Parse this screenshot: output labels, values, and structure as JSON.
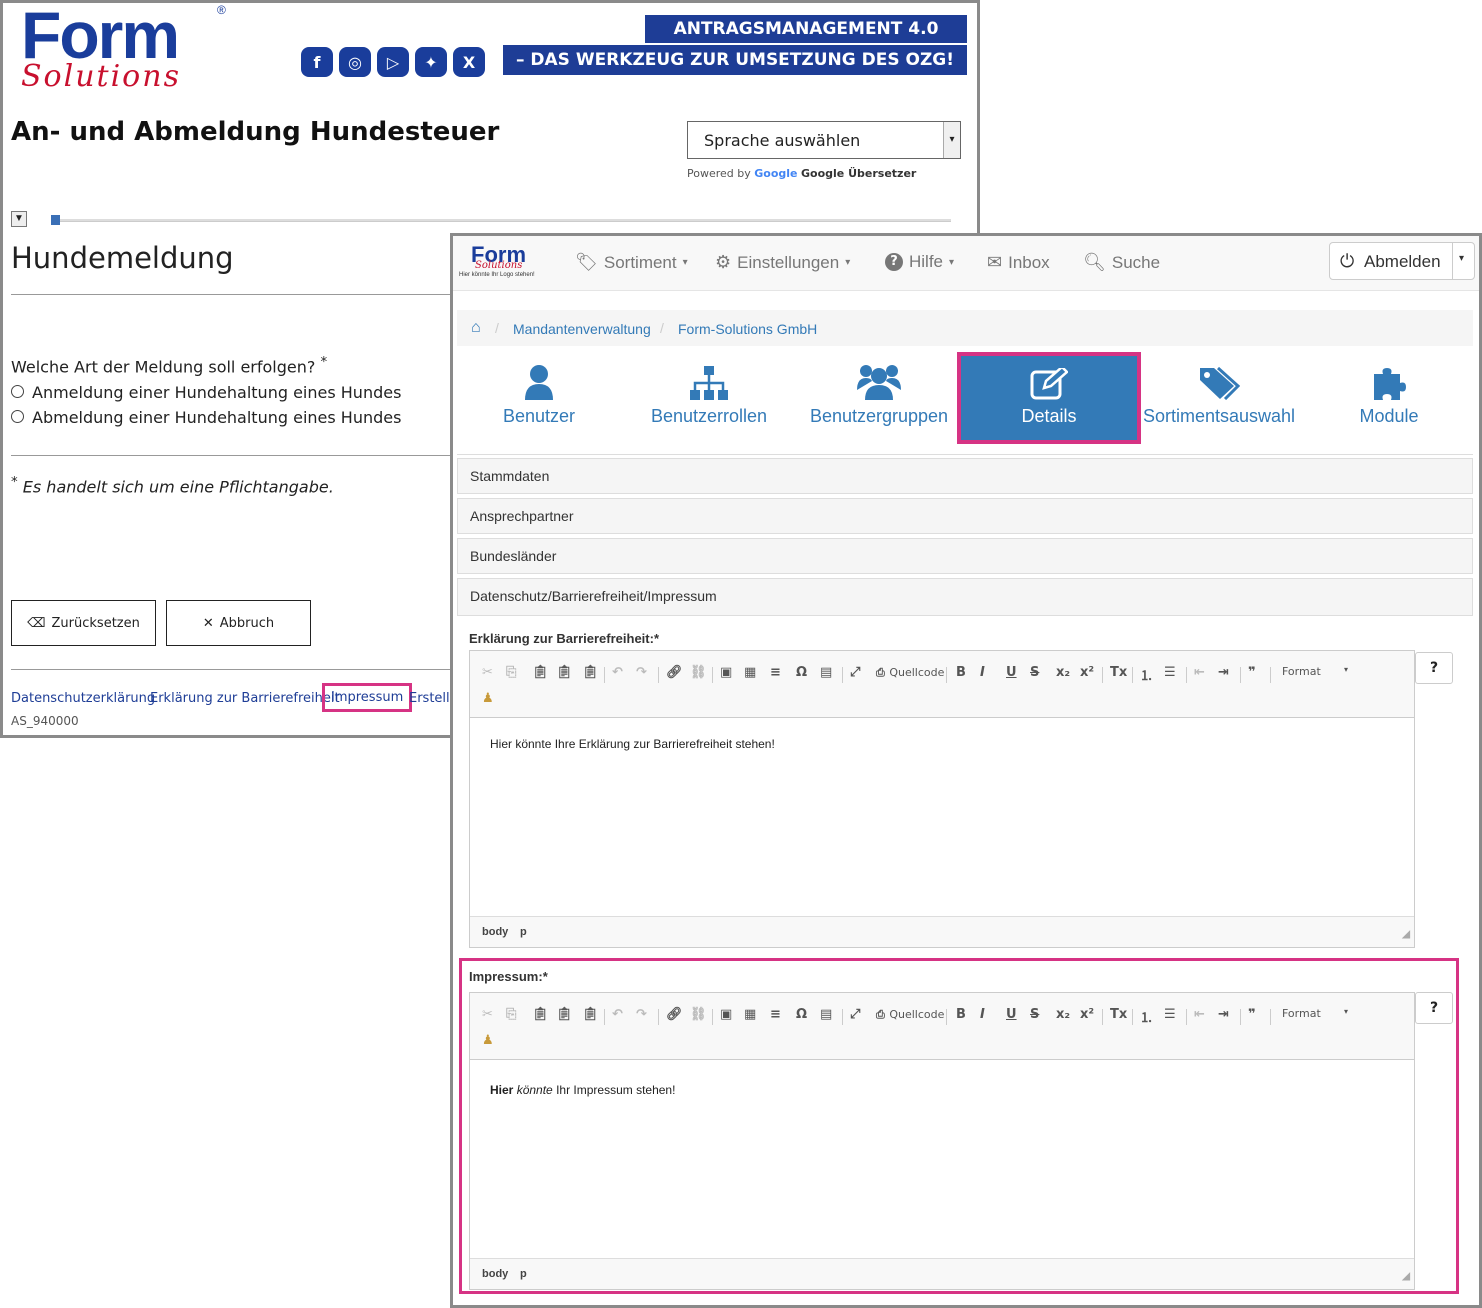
{
  "form": {
    "logo": {
      "word": "Form",
      "sub": "Solutions",
      "reg": "®"
    },
    "social_icons": [
      "facebook-icon",
      "instagram-icon",
      "youtube-icon",
      "twitter-icon",
      "x-icon"
    ],
    "banner_line1": "ANTRAGSMANAGEMENT 4.0",
    "banner_line2": "– DAS WERKZEUG ZUR UMSETZUNG DES OZG!",
    "title": "An- und Abmeldung Hundesteuer",
    "language_select": "Sprache auswählen",
    "powered_by": "Powered by",
    "google": "Google",
    "translator": "Google Übersetzer",
    "progress": 0.01,
    "section_heading": "Hundemeldung",
    "question": "Welche Art der Meldung soll erfolgen?",
    "required_mark": "*",
    "options": [
      "Anmeldung einer Hundehaltung eines Hundes",
      "Abmeldung einer Hundehaltung eines Hundes"
    ],
    "note_star": "*",
    "note": "Es handelt sich um eine Pflichtangabe.",
    "reset_label": "Zurücksetzen",
    "cancel_label": "Abbruch",
    "footer_links": [
      "Datenschutzerklärung",
      "Erklärung zur Barrierefreiheit",
      "Impressum",
      "Erstellt"
    ],
    "form_id": "AS_940000"
  },
  "admin": {
    "logo": {
      "word": "Form",
      "sub": "Solutions",
      "tagline": "Hier könnte Ihr Logo stehen!"
    },
    "nav": [
      {
        "label": "Sortiment",
        "icon": "tag-icon",
        "dropdown": true
      },
      {
        "label": "Einstellungen",
        "icon": "gear-icon",
        "dropdown": true
      },
      {
        "label": "Hilfe",
        "icon": "question-icon",
        "dropdown": true
      },
      {
        "label": "Inbox",
        "icon": "envelope-icon",
        "dropdown": false
      },
      {
        "label": "Suche",
        "icon": "search-icon",
        "dropdown": false
      }
    ],
    "logout_label": "Abmelden",
    "breadcrumb": [
      "Mandantenverwaltung",
      "Form-Solutions GmbH"
    ],
    "tiles": [
      {
        "label": "Benutzer",
        "icon": "user-icon"
      },
      {
        "label": "Benutzerrollen",
        "icon": "sitemap-icon"
      },
      {
        "label": "Benutzergruppen",
        "icon": "users-icon"
      },
      {
        "label": "Details",
        "icon": "edit-icon",
        "active": true
      },
      {
        "label": "Sortimentsauswahl",
        "icon": "tags-icon"
      },
      {
        "label": "Module",
        "icon": "puzzle-icon"
      }
    ],
    "panels": [
      "Stammdaten",
      "Ansprechpartner",
      "Bundesländer",
      "Datenschutz/Barrierefreiheit/Impressum"
    ],
    "editor_toolbar_source": "Quellcode",
    "editor_toolbar_format": "Format",
    "editor1": {
      "label": "Erklärung zur Barrierefreiheit:*",
      "content": "Hier könnte Ihre Erklärung zur Barrierefreiheit stehen!",
      "status": [
        "body",
        "p"
      ]
    },
    "editor2": {
      "label": "Impressum:*",
      "content_bold": "Hier",
      "content_italic": "könnte",
      "content_rest": "Ihr Impressum stehen!",
      "status": [
        "body",
        "p"
      ]
    },
    "help_symbol": "?",
    "accent_color": "#337ab7",
    "highlight_color": "#d63384"
  }
}
